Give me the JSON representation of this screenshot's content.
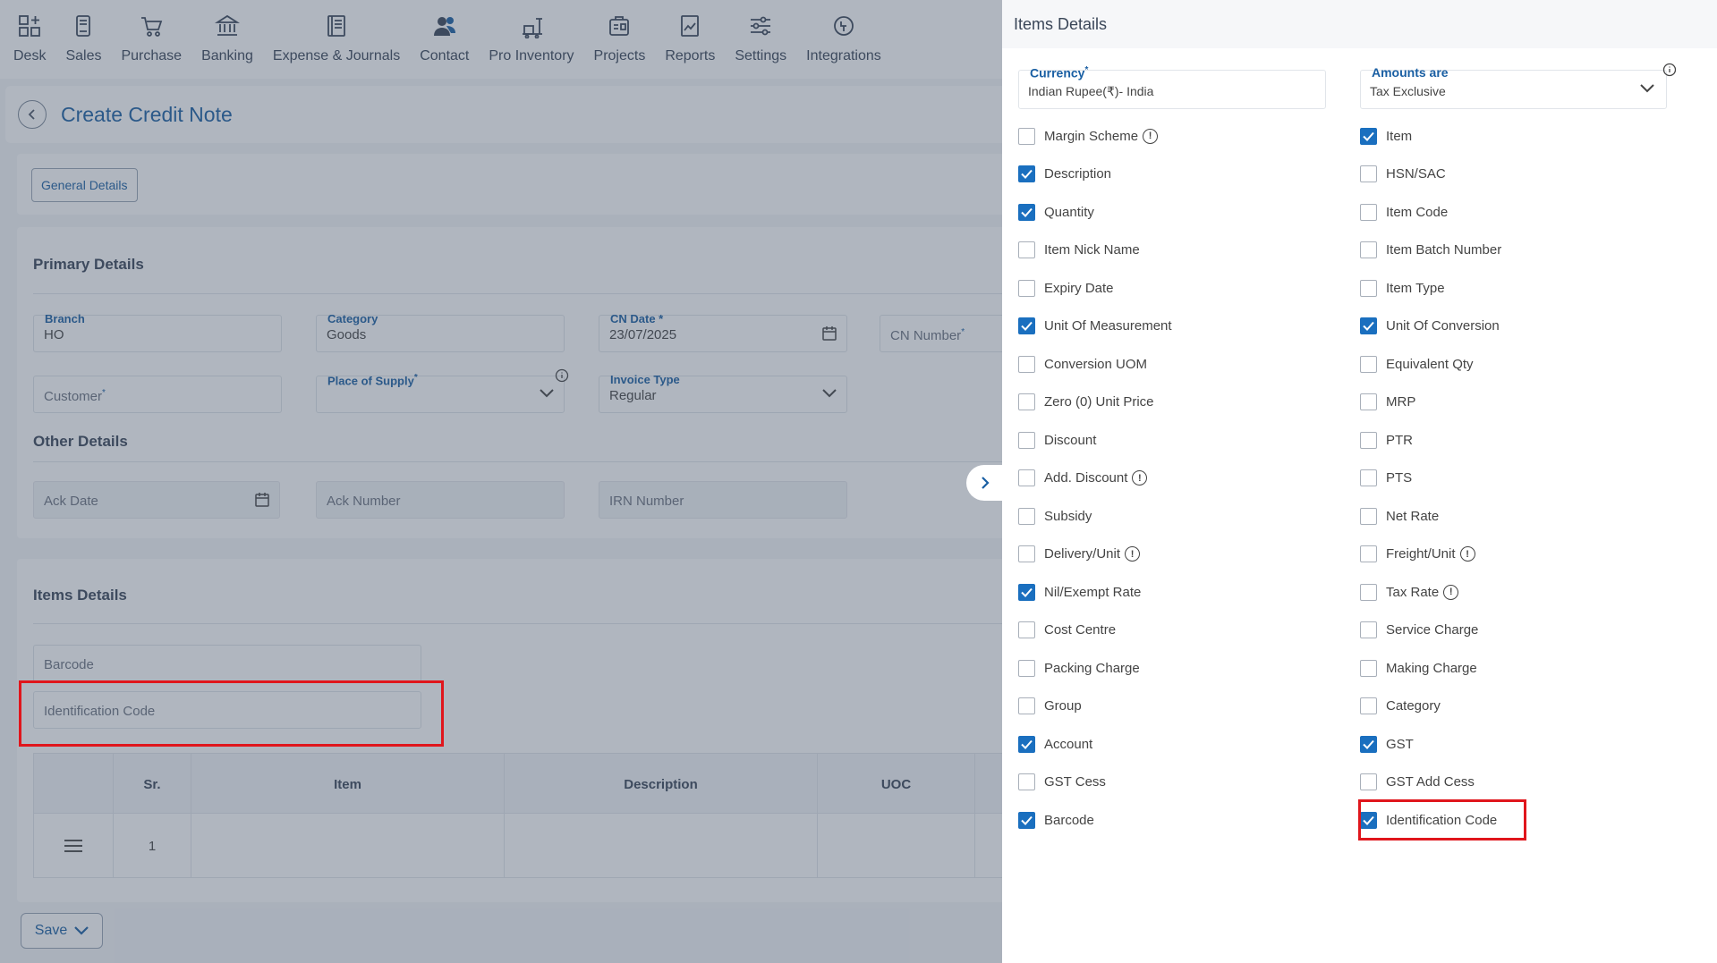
{
  "nav": [
    {
      "label": "Desk",
      "icon": "desk-icon"
    },
    {
      "label": "Sales",
      "icon": "sales-icon"
    },
    {
      "label": "Purchase",
      "icon": "cart-icon"
    },
    {
      "label": "Banking",
      "icon": "bank-icon"
    },
    {
      "label": "Expense & Journals",
      "icon": "journal-icon"
    },
    {
      "label": "Contact",
      "icon": "contact-icon"
    },
    {
      "label": "Pro Inventory",
      "icon": "inventory-icon"
    },
    {
      "label": "Projects",
      "icon": "projects-icon"
    },
    {
      "label": "Reports",
      "icon": "reports-icon"
    },
    {
      "label": "Settings",
      "icon": "settings-icon"
    },
    {
      "label": "Integrations",
      "icon": "integrations-icon"
    }
  ],
  "header": {
    "title": "Create Credit Note"
  },
  "tabs": {
    "general": "General Details"
  },
  "primary": {
    "title": "Primary Details",
    "branch": {
      "label": "Branch",
      "value": "HO"
    },
    "category": {
      "label": "Category",
      "value": "Goods"
    },
    "cn_date": {
      "label": "CN Date *",
      "value": "23/07/2025"
    },
    "cn_number": {
      "placeholder": "CN Number"
    },
    "customer": {
      "placeholder": "Customer"
    },
    "place_of_supply": {
      "label": "Place of Supply"
    },
    "invoice_type": {
      "label": "Invoice Type",
      "value": "Regular"
    }
  },
  "other": {
    "title": "Other Details",
    "ack_date": "Ack Date",
    "ack_number": "Ack Number",
    "irn_number": "IRN Number"
  },
  "items": {
    "title": "Items Details",
    "barcode": "Barcode",
    "identification_code": "Identification Code",
    "columns": [
      "Sr.",
      "Item",
      "Description",
      "UOC"
    ],
    "row": {
      "sr": "1"
    }
  },
  "save": {
    "label": "Save"
  },
  "drawer": {
    "title": "Items Details",
    "currency": {
      "label": "Currency",
      "value": "Indian Rupee(₹)- India"
    },
    "amounts": {
      "label": "Amounts are",
      "value": "Tax Exclusive"
    },
    "left": [
      {
        "label": "Margin Scheme",
        "checked": false,
        "info": true
      },
      {
        "label": "Description",
        "checked": true,
        "info": false
      },
      {
        "label": "Quantity",
        "checked": true,
        "info": false
      },
      {
        "label": "Item Nick Name",
        "checked": false,
        "info": false
      },
      {
        "label": "Expiry Date",
        "checked": false,
        "info": false
      },
      {
        "label": "Unit Of Measurement",
        "checked": true,
        "info": false
      },
      {
        "label": "Conversion UOM",
        "checked": false,
        "info": false
      },
      {
        "label": "Zero (0) Unit Price",
        "checked": false,
        "info": false
      },
      {
        "label": "Discount",
        "checked": false,
        "info": false
      },
      {
        "label": "Add. Discount",
        "checked": false,
        "info": true
      },
      {
        "label": "Subsidy",
        "checked": false,
        "info": false
      },
      {
        "label": "Delivery/Unit",
        "checked": false,
        "info": true
      },
      {
        "label": "Nil/Exempt Rate",
        "checked": true,
        "info": false
      },
      {
        "label": "Cost Centre",
        "checked": false,
        "info": false
      },
      {
        "label": "Packing Charge",
        "checked": false,
        "info": false
      },
      {
        "label": "Group",
        "checked": false,
        "info": false
      },
      {
        "label": "Account",
        "checked": true,
        "info": false
      },
      {
        "label": "GST Cess",
        "checked": false,
        "info": false
      },
      {
        "label": "Barcode",
        "checked": true,
        "info": false
      }
    ],
    "right": [
      {
        "label": "Item",
        "checked": true,
        "info": false
      },
      {
        "label": "HSN/SAC",
        "checked": false,
        "info": false
      },
      {
        "label": "Item Code",
        "checked": false,
        "info": false
      },
      {
        "label": "Item Batch Number",
        "checked": false,
        "info": false
      },
      {
        "label": "Item Type",
        "checked": false,
        "info": false
      },
      {
        "label": "Unit Of Conversion",
        "checked": true,
        "info": false
      },
      {
        "label": "Equivalent Qty",
        "checked": false,
        "info": false
      },
      {
        "label": "MRP",
        "checked": false,
        "info": false
      },
      {
        "label": "PTR",
        "checked": false,
        "info": false
      },
      {
        "label": "PTS",
        "checked": false,
        "info": false
      },
      {
        "label": "Net Rate",
        "checked": false,
        "info": false
      },
      {
        "label": "Freight/Unit",
        "checked": false,
        "info": true
      },
      {
        "label": "Tax Rate",
        "checked": false,
        "info": true
      },
      {
        "label": "Service Charge",
        "checked": false,
        "info": false
      },
      {
        "label": "Making Charge",
        "checked": false,
        "info": false
      },
      {
        "label": "Category",
        "checked": false,
        "info": false
      },
      {
        "label": "GST",
        "checked": true,
        "info": false
      },
      {
        "label": "GST Add Cess",
        "checked": false,
        "info": false
      },
      {
        "label": "Identification Code",
        "checked": true,
        "info": false
      }
    ]
  }
}
